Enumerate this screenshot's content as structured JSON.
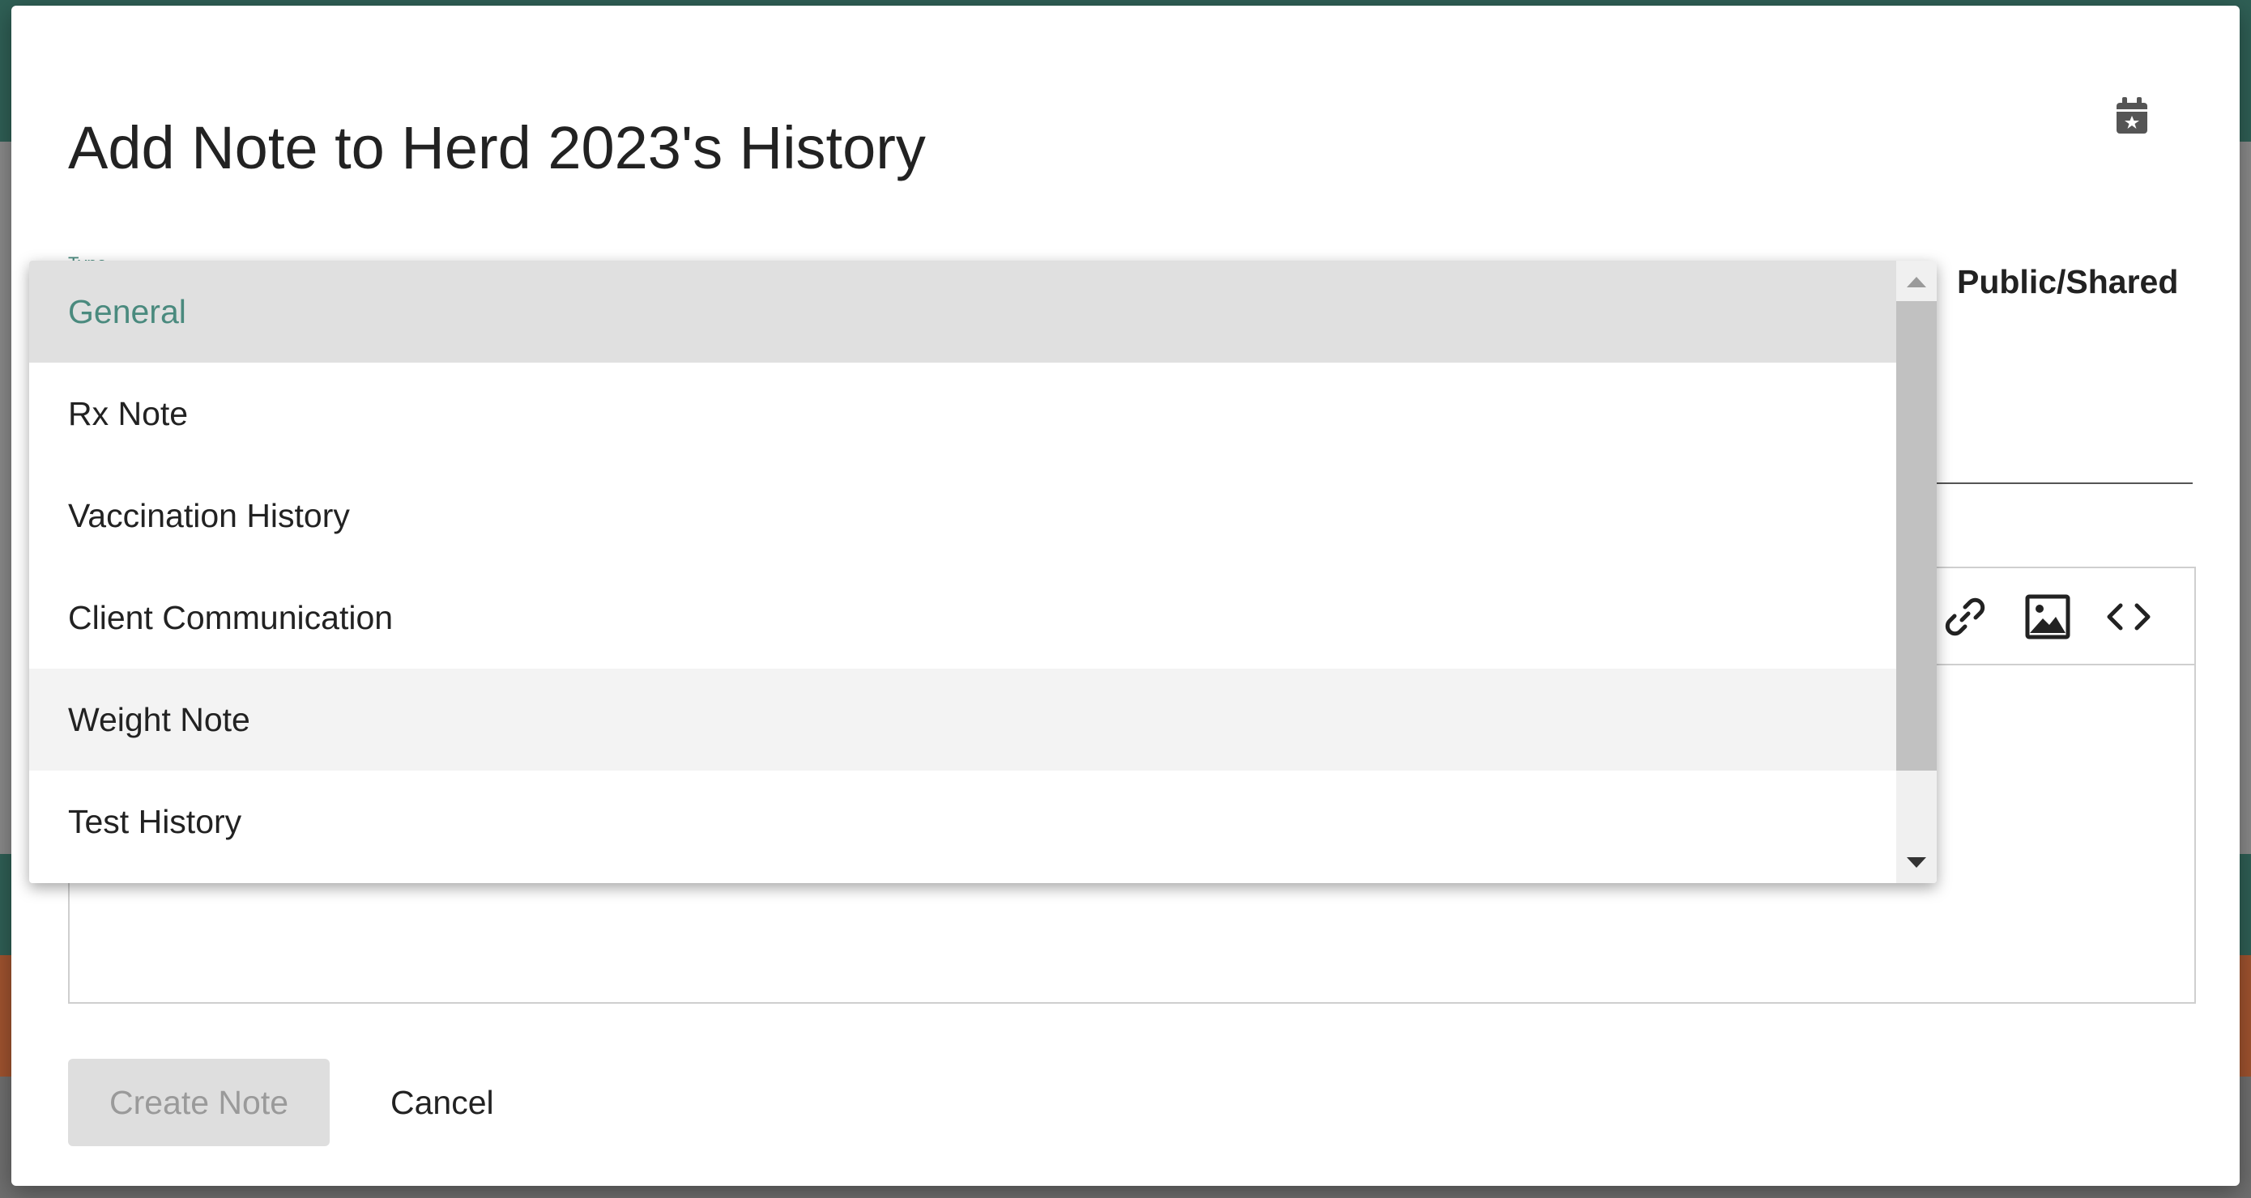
{
  "dialog": {
    "title": "Add Note to Herd 2023's History",
    "type_label": "Type",
    "public_label": "Public/Shared",
    "create_button": "Create Note",
    "cancel_button": "Cancel"
  },
  "dropdown": {
    "selected": "General",
    "options": [
      "General",
      "Rx Note",
      "Vaccination History",
      "Client Communication",
      "Weight Note",
      "Test History"
    ]
  },
  "icons": [
    "calendar-star-icon",
    "link-icon",
    "image-icon",
    "code-icon",
    "scroll-up-arrow-icon",
    "scroll-down-arrow-icon"
  ],
  "colors": {
    "accent": "#4a8a7e",
    "header_band": "#2f5f55",
    "orange_band": "#a0532f"
  }
}
